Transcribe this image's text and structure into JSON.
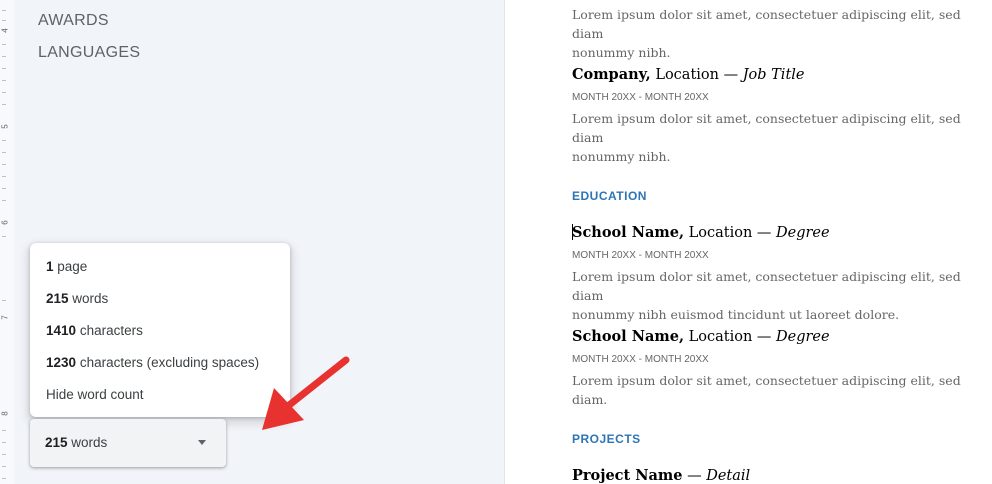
{
  "outline": {
    "items": [
      {
        "label": "AWARDS"
      },
      {
        "label": "LANGUAGES"
      }
    ]
  },
  "ruler": {
    "numbers": [
      "4",
      "5",
      "6",
      "7",
      "8"
    ]
  },
  "word_count_popup": {
    "rows": [
      {
        "value": "1",
        "unit": "page"
      },
      {
        "value": "215",
        "unit": "words"
      },
      {
        "value": "1410",
        "unit": "characters"
      },
      {
        "value": "1230",
        "unit": "characters (excluding spaces)"
      }
    ],
    "hide_label": "Hide word count"
  },
  "word_count_chip": {
    "value": "215",
    "unit": "words"
  },
  "annotation": {
    "arrow_color": "#e8322f"
  },
  "document": {
    "top_text_line1": "Lorem ipsum dolor sit amet, consectetuer adipiscing elit, sed diam",
    "top_text_line2": "nonummy nibh.",
    "job": {
      "company": "Company,",
      "location": " Location — ",
      "title": "Job Title",
      "date": "MONTH 20XX - MONTH 20XX",
      "text_line1": "Lorem ipsum dolor sit amet, consectetuer adipiscing elit, sed diam",
      "text_line2": "nonummy nibh."
    },
    "education_heading": "EDUCATION",
    "school1": {
      "name": "School Name,",
      "location": " Location — ",
      "degree": "Degree",
      "date": "MONTH 20XX - MONTH 20XX",
      "text_line1": "Lorem ipsum dolor sit amet, consectetuer adipiscing elit, sed diam",
      "text_line2": "nonummy nibh euismod tincidunt ut laoreet dolore."
    },
    "school2": {
      "name": "School Name,",
      "location": " Location — ",
      "degree": "Degree",
      "date": "MONTH 20XX - MONTH 20XX",
      "text_line1": "Lorem ipsum dolor sit amet, consectetuer adipiscing elit, sed diam."
    },
    "projects_heading": "PROJECTS",
    "project": {
      "name": "Project Name",
      "sep": " — ",
      "detail": "Detail"
    }
  }
}
